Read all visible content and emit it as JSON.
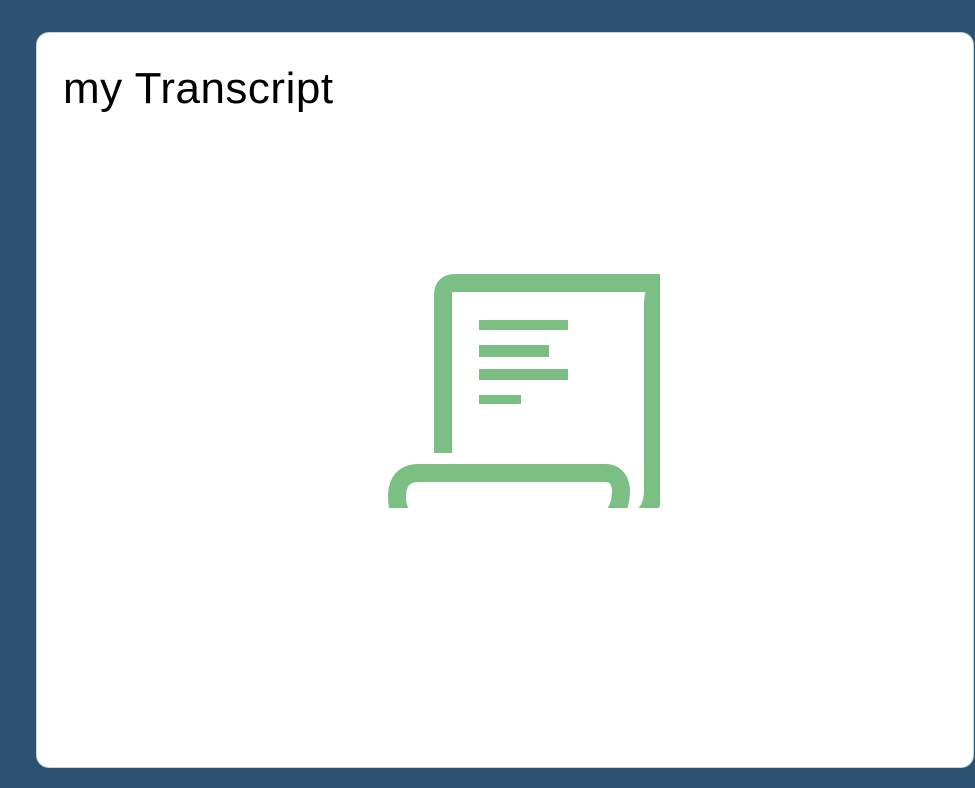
{
  "tile": {
    "title": "my Transcript",
    "icon": "scroll-document-icon",
    "icon_color": "#7bbf85",
    "background_color": "#ffffff",
    "frame_color": "#2d5170"
  }
}
